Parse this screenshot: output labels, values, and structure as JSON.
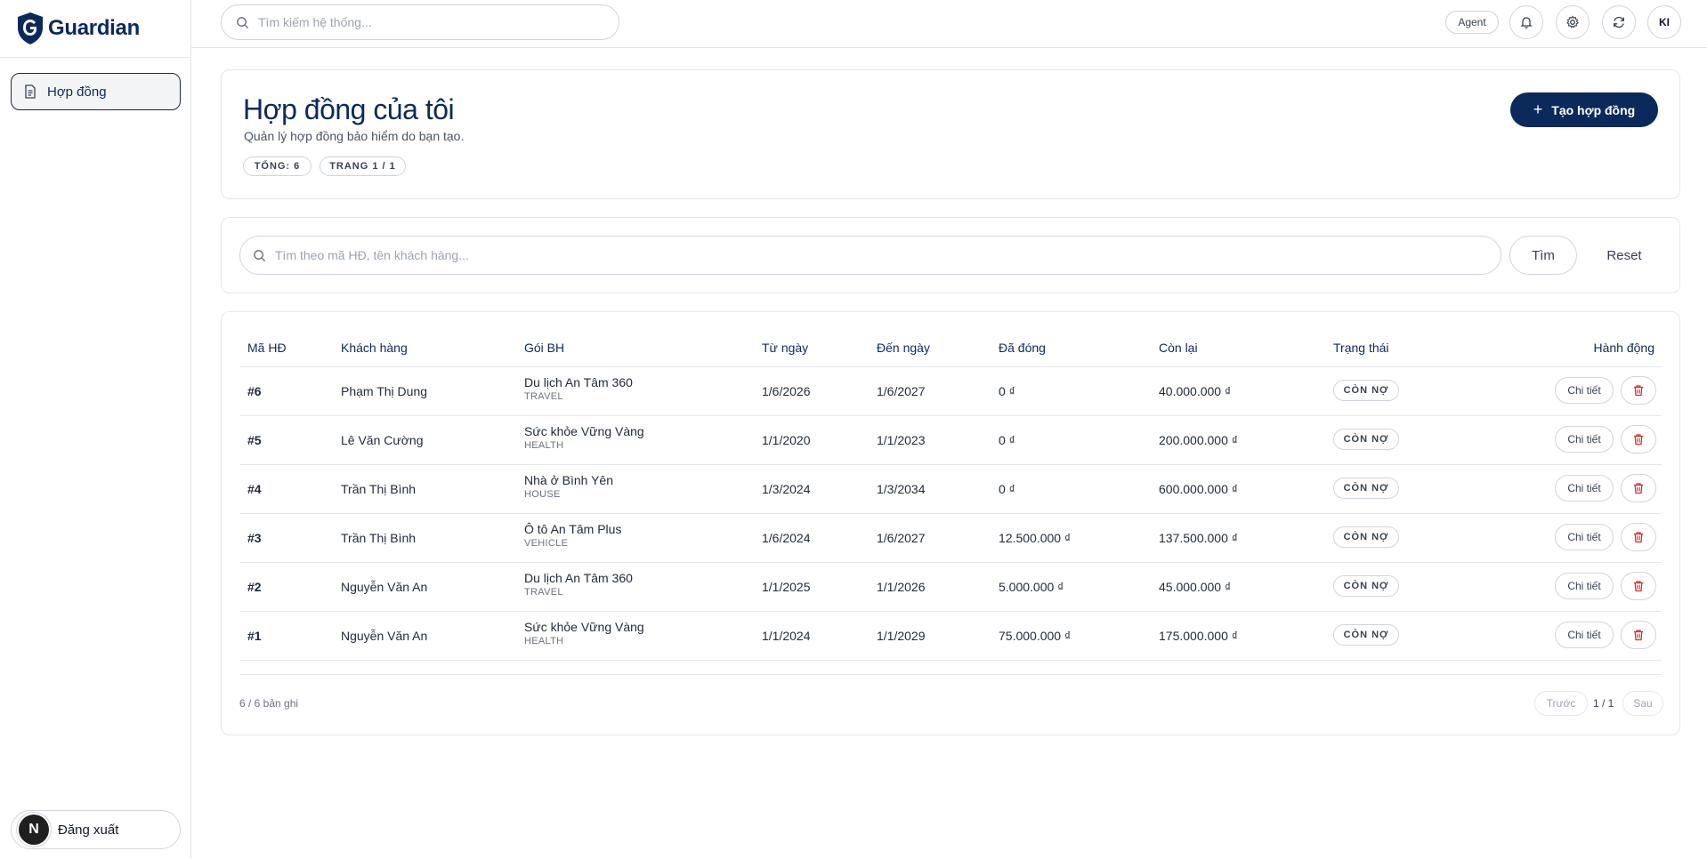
{
  "brand": {
    "name": "Guardian",
    "logo_letter": "G"
  },
  "sidebar": {
    "items": [
      {
        "label": "Hợp đồng",
        "icon": "document-icon"
      }
    ],
    "logout": {
      "label": "Đăng xuất",
      "badge": "N"
    }
  },
  "topbar": {
    "search_placeholder": "Tìm kiếm hệ thống...",
    "role": "Agent",
    "icons": [
      "bell-icon",
      "gear-icon",
      "refresh-icon"
    ],
    "avatar": "KI"
  },
  "header": {
    "title": "Hợp đồng của tôi",
    "subtitle": "Quản lý hợp đồng bảo hiểm do bạn tạo.",
    "total_chip": "TỔNG: 6",
    "page_chip": "TRANG 1 / 1",
    "create_button": "Tạo hợp đồng"
  },
  "filter": {
    "placeholder": "Tìm theo mã HĐ, tên khách hàng...",
    "find_label": "Tìm",
    "reset_label": "Reset"
  },
  "table": {
    "columns": [
      "Mã HĐ",
      "Khách hàng",
      "Gói BH",
      "Từ ngày",
      "Đến ngày",
      "Đã đóng",
      "Còn lại",
      "Trạng thái",
      "Hành động"
    ],
    "detail_label": "Chi tiết",
    "rows": [
      {
        "id": "#6",
        "customer": "Phạm Thị Dung",
        "package": "Du lịch An Tâm 360",
        "package_type": "TRAVEL",
        "from": "1/6/2026",
        "to": "1/6/2027",
        "paid": "0 ₫",
        "remaining": "40.000.000 ₫",
        "status": "CÒN NỢ"
      },
      {
        "id": "#5",
        "customer": "Lê Văn Cường",
        "package": "Sức khỏe Vững Vàng",
        "package_type": "HEALTH",
        "from": "1/1/2020",
        "to": "1/1/2023",
        "paid": "0 ₫",
        "remaining": "200.000.000 ₫",
        "status": "CÒN NỢ"
      },
      {
        "id": "#4",
        "customer": "Trần Thị Bình",
        "package": "Nhà ở Bình Yên",
        "package_type": "HOUSE",
        "from": "1/3/2024",
        "to": "1/3/2034",
        "paid": "0 ₫",
        "remaining": "600.000.000 ₫",
        "status": "CÒN NỢ"
      },
      {
        "id": "#3",
        "customer": "Trần Thị Bình",
        "package": "Ô tô An Tâm Plus",
        "package_type": "VEHICLE",
        "from": "1/6/2024",
        "to": "1/6/2027",
        "paid": "12.500.000 ₫",
        "remaining": "137.500.000 ₫",
        "status": "CÒN NỢ"
      },
      {
        "id": "#2",
        "customer": "Nguyễn Văn An",
        "package": "Du lịch An Tâm 360",
        "package_type": "TRAVEL",
        "from": "1/1/2025",
        "to": "1/1/2026",
        "paid": "5.000.000 ₫",
        "remaining": "45.000.000 ₫",
        "status": "CÒN NỢ"
      },
      {
        "id": "#1",
        "customer": "Nguyễn Văn An",
        "package": "Sức khỏe Vững Vàng",
        "package_type": "HEALTH",
        "from": "1/1/2024",
        "to": "1/1/2029",
        "paid": "75.000.000 ₫",
        "remaining": "175.000.000 ₫",
        "status": "CÒN NỢ"
      }
    ]
  },
  "pagination": {
    "record_count": "6 / 6 bản ghi",
    "prev_label": "Trước",
    "page": "1 / 1",
    "next_label": "Sau"
  },
  "colors": {
    "brand": "#0b2a5b",
    "danger": "#dc2626",
    "border": "#d1d5db"
  }
}
